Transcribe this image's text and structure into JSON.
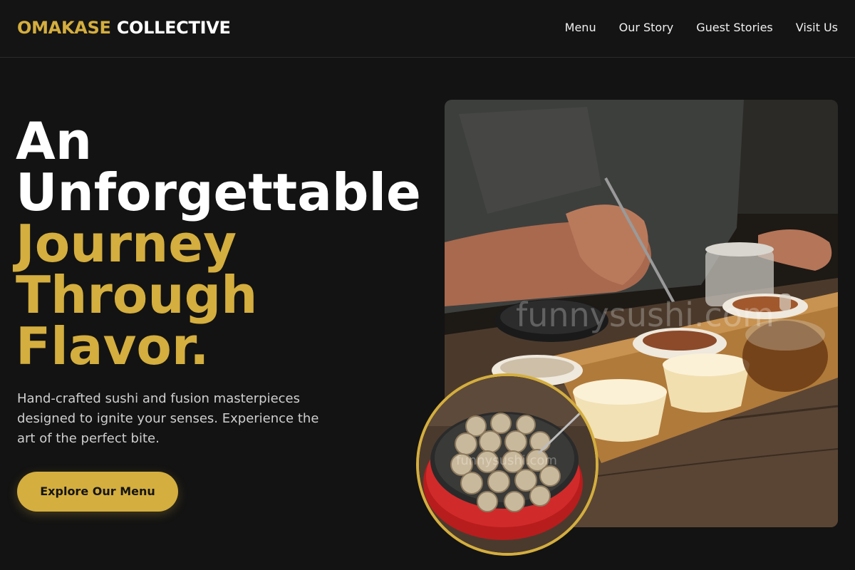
{
  "brand": {
    "accent": "OMAKASE",
    "rest": "COLLECTIVE",
    "accent_color": "#d4ae3e"
  },
  "nav": {
    "items": [
      {
        "label": "Menu"
      },
      {
        "label": "Our Story"
      },
      {
        "label": "Guest Stories"
      },
      {
        "label": "Visit Us"
      }
    ]
  },
  "hero": {
    "heading_white": [
      "An",
      "Unforgettable"
    ],
    "heading_gold": [
      "Journey",
      "Through",
      "Flavor."
    ],
    "description": "Hand-crafted sushi and fusion masterpieces designed to ignite your senses. Experience the art of the perfect bite.",
    "cta_label": "Explore Our Menu"
  },
  "images": {
    "main_watermark": "funnysushi.com",
    "inset_watermark": "funnysushi.com"
  }
}
